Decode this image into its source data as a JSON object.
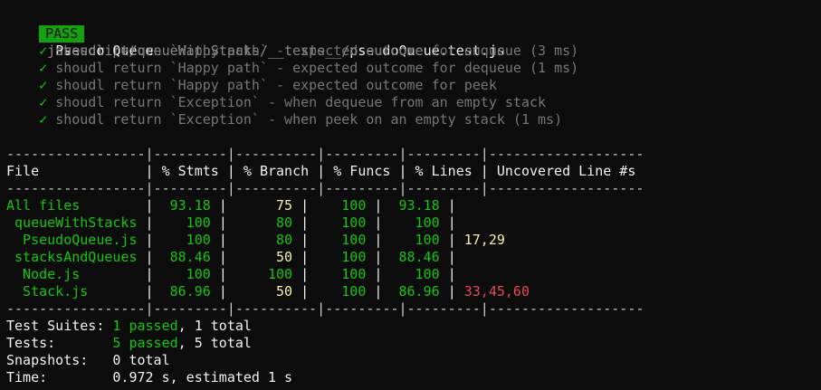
{
  "header": {
    "status": "PASS",
    "path_dim": "javascript/queueWithStacks/__tests__/",
    "file": "pseudoQueue.test.js"
  },
  "suite": {
    "name": "Pseudo Queue",
    "tests": [
      {
        "check": "✓",
        "text": "shoudl return `Happy path` - expected outcome for enqueue (3 ms)"
      },
      {
        "check": "✓",
        "text": "shoudl return `Happy path` - expected outcome for dequeue (1 ms)"
      },
      {
        "check": "✓",
        "text": "shoudl return `Happy path` - expected outcome for peek"
      },
      {
        "check": "✓",
        "text": "shoudl return `Exception` - when dequeue from an empty stack"
      },
      {
        "check": "✓",
        "text": "shoudl return `Exception` - when peek on an empty stack (1 ms)"
      }
    ]
  },
  "coverage": {
    "separator": "-----------------|---------|----------|---------|---------|-------------------",
    "header_row": "File             | % Stmts | % Branch | % Funcs | % Lines | Uncovered Line #s ",
    "rows": [
      {
        "file": "All files        ",
        "stmts": "  93.18 ",
        "branch": "      75 ",
        "funcs": "    100 ",
        "lines": "  93.18 ",
        "uncovered": "",
        "branch_color": "yellow",
        "uncovered_color": "yellow"
      },
      {
        "file": " queueWithStacks ",
        "stmts": "    100 ",
        "branch": "      80 ",
        "funcs": "    100 ",
        "lines": "    100 ",
        "uncovered": "",
        "branch_color": "green",
        "uncovered_color": "yellow"
      },
      {
        "file": "  PseudoQueue.js ",
        "stmts": "    100 ",
        "branch": "      80 ",
        "funcs": "    100 ",
        "lines": "    100 ",
        "uncovered": "17,29",
        "branch_color": "green",
        "uncovered_color": "yellow"
      },
      {
        "file": " stacksAndQueues ",
        "stmts": "  88.46 ",
        "branch": "      50 ",
        "funcs": "    100 ",
        "lines": "  88.46 ",
        "uncovered": "",
        "branch_color": "yellow",
        "uncovered_color": "yellow"
      },
      {
        "file": "  Node.js        ",
        "stmts": "    100 ",
        "branch": "     100 ",
        "funcs": "    100 ",
        "lines": "    100 ",
        "uncovered": "",
        "branch_color": "green",
        "uncovered_color": "yellow"
      },
      {
        "file": "  Stack.js       ",
        "stmts": "  86.96 ",
        "branch": "      50 ",
        "funcs": "    100 ",
        "lines": "  86.96 ",
        "uncovered": "33,45,60",
        "branch_color": "yellow",
        "uncovered_color": "red"
      }
    ]
  },
  "summary": {
    "suites_label": "Test Suites: ",
    "suites_passed": "1 passed",
    "suites_total": ", 1 total",
    "tests_label": "Tests:       ",
    "tests_passed": "5 passed",
    "tests_total": ", 5 total",
    "snapshots_label": "Snapshots:   ",
    "snapshots_value": "0 total",
    "time_label": "Time:        ",
    "time_value": "0.972 s, estimated 1 s"
  },
  "colors": {
    "background": "#0c0c0c",
    "pass_badge": "#13a10e",
    "green": "#16c60c",
    "yellow": "#f9f1a5",
    "red": "#e74856",
    "text": "#cccccc"
  }
}
